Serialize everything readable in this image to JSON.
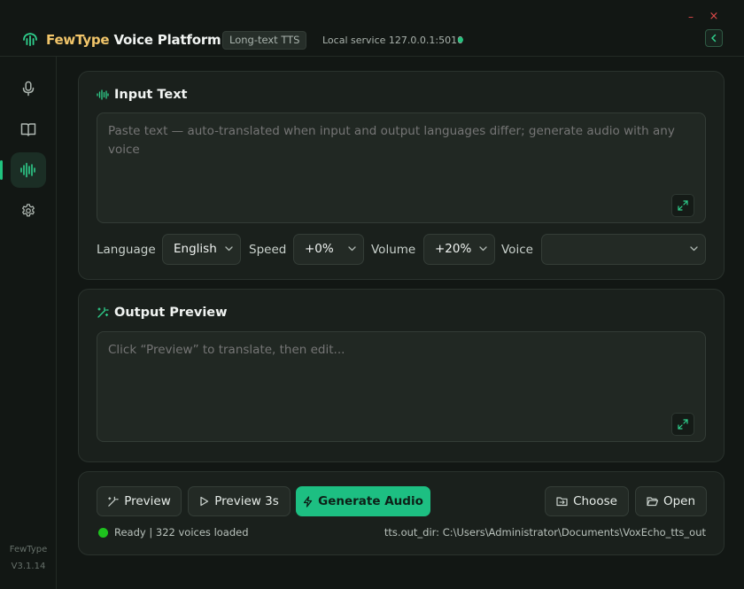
{
  "app": {
    "brand_first": "FewType",
    "brand_second": "Voice Platform",
    "mode_badge": "Long-text TTS",
    "service_status": "Local service 127.0.0.1:5010",
    "name": "FewType",
    "version": "V3.1.14",
    "accent_color": "#1dbf82",
    "brand_color": "#f1c56a"
  },
  "window_controls": {
    "minimize": "–",
    "close": "×"
  },
  "sidebar": {
    "items": [
      {
        "name": "microphone",
        "icon": "microphone-icon"
      },
      {
        "name": "book",
        "icon": "book-icon"
      },
      {
        "name": "waveform",
        "icon": "waveform-icon",
        "active": true
      },
      {
        "name": "settings",
        "icon": "gear-icon"
      }
    ]
  },
  "input_section": {
    "title": "Input Text",
    "placeholder": "Paste text — auto-translated when input and output languages differ; generate audio with any voice",
    "controls": {
      "language_label": "Language",
      "language_value": "English",
      "speed_label": "Speed",
      "speed_value": "+0%",
      "volume_label": "Volume",
      "volume_value": "+20%",
      "voice_label": "Voice",
      "voice_value": ""
    }
  },
  "output_section": {
    "title": "Output Preview",
    "placeholder": "Click “Preview” to translate, then edit..."
  },
  "actions": {
    "preview": "Preview",
    "preview_3s": "Preview 3s",
    "generate": "Generate Audio",
    "choose": "Choose",
    "open": "Open"
  },
  "status": {
    "text": "Ready | 322 voices loaded",
    "out_dir": "tts.out_dir: C:\\Users\\Administrator\\Documents\\VoxEcho_tts_out"
  }
}
